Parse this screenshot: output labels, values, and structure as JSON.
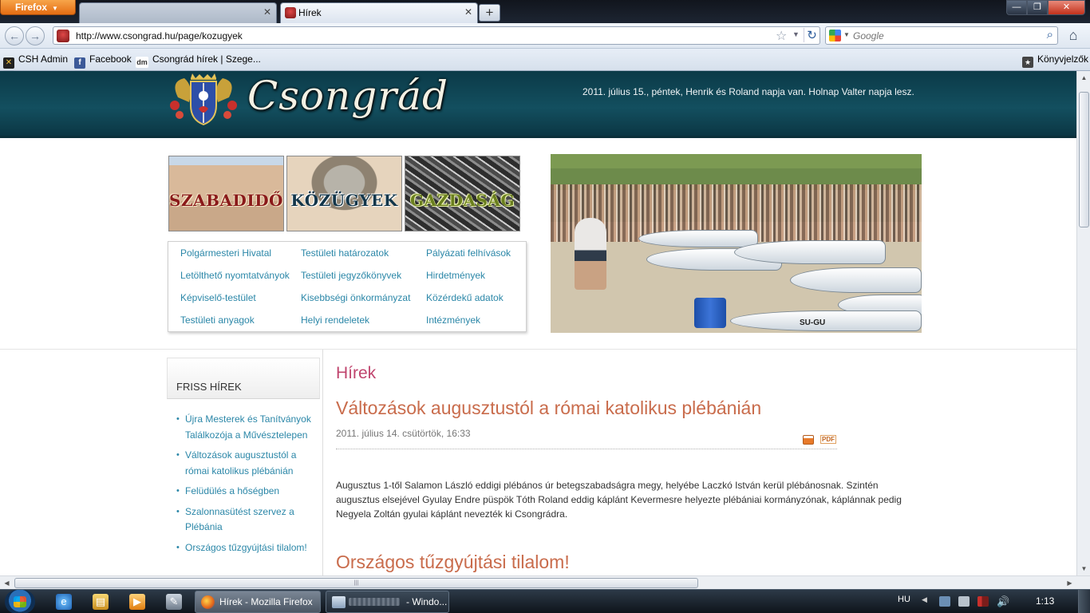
{
  "browser": {
    "menu_button": "Firefox",
    "tabs": [
      {
        "label": "",
        "state": "inactive"
      },
      {
        "label": "Hírek",
        "state": "active"
      }
    ],
    "url": "http://www.csongrad.hu/page/kozugyek",
    "search_placeholder": "Google",
    "bookmarks": [
      {
        "label": "CSH Admin",
        "icon": "csh-icon"
      },
      {
        "label": "Facebook",
        "icon": "facebook-icon"
      },
      {
        "label": "Csongrád hírek | Szege...",
        "icon": "dm-icon"
      }
    ],
    "bookmarks_menu": "Könyvjelzők"
  },
  "site": {
    "logo_text": "Csongrád",
    "nameday": "2011. július 15., péntek, Henrik és Roland napja van. Holnap Valter napja lesz.",
    "category_tiles": [
      {
        "label": "SZABADIDŐ",
        "color": "#8a1a1a"
      },
      {
        "label": "KÖZÜGYEK",
        "color": "#13364a"
      },
      {
        "label": "GAZDASÁG",
        "color": "#6a7f1e"
      }
    ],
    "quick_links": [
      [
        "Polgármesteri Hivatal",
        "Testületi határozatok",
        "Pályázati felhívások"
      ],
      [
        "Letölthető nyomtatványok",
        "Testületi jegyzőkönyvek",
        "Hirdetmények"
      ],
      [
        "Képviselő-testület",
        "Kisebbségi önkormányzat",
        "Közérdekű adatok"
      ],
      [
        "Testületi anyagok",
        "Helyi rendeletek",
        "Intézmények"
      ]
    ],
    "photo_boat_id": "SU-GU",
    "link_color": "#2b87a8",
    "accent_color": "#c96c4c"
  },
  "sidebar": {
    "title": "FRISS HÍREK",
    "items": [
      "Újra Mesterek és Tanítványok Találkozója a Művésztelepen",
      "Változások augusztustól a római katolikus plébánián",
      "Felüdülés a hőségben",
      "Szalonnasütést szervez a Plébánia",
      "Országos tűzgyújtási tilalom!"
    ]
  },
  "main": {
    "section_title": "Hírek",
    "article1": {
      "title": "Változások augusztustól a római katolikus plébánián",
      "date": "2011. július 14. csütörtök, 16:33",
      "pdf_label": "PDF",
      "body": "Augusztus 1-től Salamon László eddigi plébános úr betegszabadságra megy, helyébe Laczkó István kerül plébánosnak. Szintén augusztus elsejével Gyulay Endre püspök Tóth Roland eddig káplánt Kevermesre helyezte plébániai kormányzónak, káplánnak pedig Negyela Zoltán gyulai káplánt nevezték ki Csongrádra."
    },
    "article2": {
      "title": "Országos tűzgyújtási tilalom!"
    }
  },
  "taskbar": {
    "tasks": [
      {
        "label": "Hírek - Mozilla Firefox"
      },
      {
        "label": "- Windo..."
      }
    ],
    "language": "HU",
    "clock": "1:13"
  }
}
